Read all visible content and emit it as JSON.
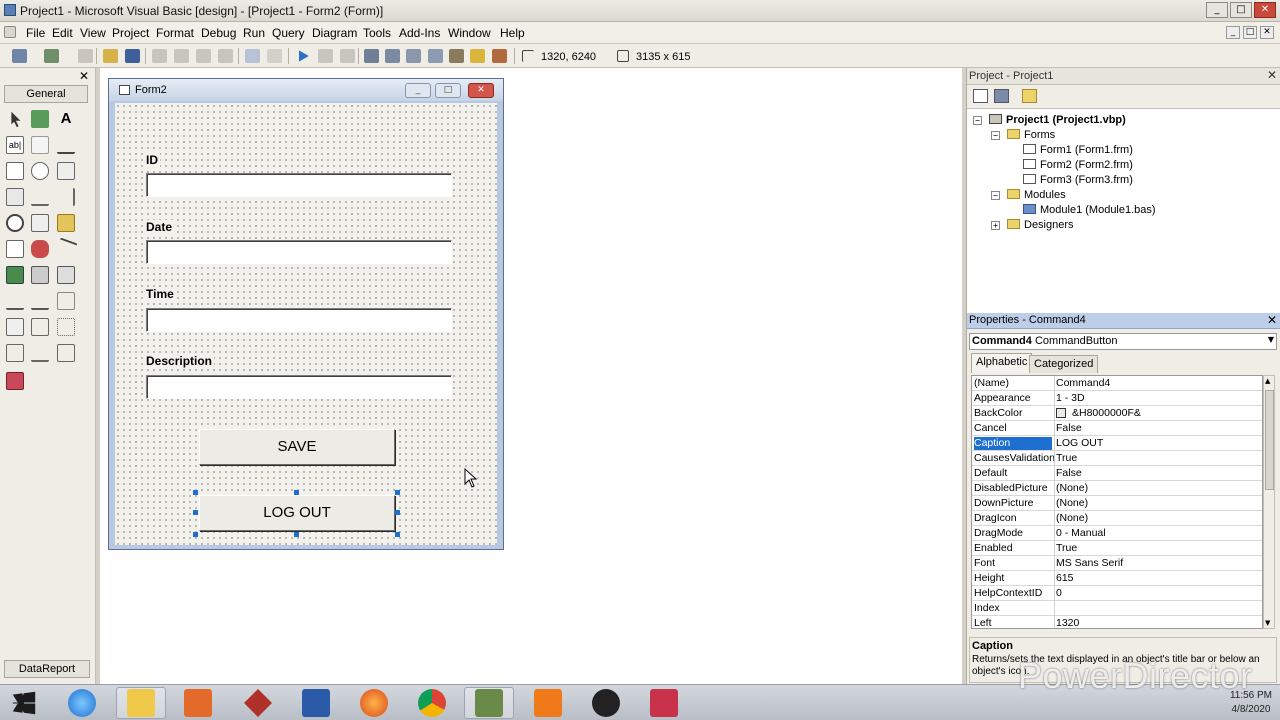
{
  "window": {
    "title": "Project1 - Microsoft Visual Basic [design] - [Project1 - Form2 (Form)]",
    "min": "_",
    "max": "□",
    "close": "✕"
  },
  "menu": [
    "File",
    "Edit",
    "View",
    "Project",
    "Format",
    "Debug",
    "Run",
    "Query",
    "Diagram",
    "Tools",
    "Add-Ins",
    "Window",
    "Help"
  ],
  "toolbar": {
    "position": "1320, 6240",
    "size": "3135 x 615"
  },
  "toolbox": {
    "title": "General",
    "close": "✕",
    "footer": "DataReport"
  },
  "form": {
    "title": "Form2",
    "labels": {
      "id": "ID",
      "date": "Date",
      "time": "Time",
      "description": "Description"
    },
    "inputs": {
      "id": "",
      "date": "",
      "time": "",
      "description": ""
    },
    "buttons": {
      "save": "SAVE",
      "logout": "LOG OUT"
    }
  },
  "project": {
    "title": "Project - Project1",
    "close": "✕",
    "tree": {
      "root": "Project1 (Project1.vbp)",
      "forms_folder": "Forms",
      "forms": [
        "Form1 (Form1.frm)",
        "Form2 (Form2.frm)",
        "Form3 (Form3.frm)"
      ],
      "modules_folder": "Modules",
      "modules": [
        "Module1 (Module1.bas)"
      ],
      "designers_folder": "Designers"
    }
  },
  "properties": {
    "title": "Properties - Command4",
    "close": "✕",
    "object": "Command4",
    "object_type": "CommandButton",
    "tabs": [
      "Alphabetic",
      "Categorized"
    ],
    "rows": [
      {
        "name": "(Name)",
        "value": "Command4"
      },
      {
        "name": "Appearance",
        "value": "1 - 3D"
      },
      {
        "name": "BackColor",
        "value": "&H8000000F&"
      },
      {
        "name": "Cancel",
        "value": "False"
      },
      {
        "name": "Caption",
        "value": "LOG OUT"
      },
      {
        "name": "CausesValidation",
        "value": "True"
      },
      {
        "name": "Default",
        "value": "False"
      },
      {
        "name": "DisabledPicture",
        "value": "(None)"
      },
      {
        "name": "DownPicture",
        "value": "(None)"
      },
      {
        "name": "DragIcon",
        "value": "(None)"
      },
      {
        "name": "DragMode",
        "value": "0 - Manual"
      },
      {
        "name": "Enabled",
        "value": "True"
      },
      {
        "name": "Font",
        "value": "MS Sans Serif"
      },
      {
        "name": "Height",
        "value": "615"
      },
      {
        "name": "HelpContextID",
        "value": "0"
      },
      {
        "name": "Index",
        "value": ""
      },
      {
        "name": "Left",
        "value": "1320"
      }
    ],
    "selected_row": 4,
    "desc_title": "Caption",
    "desc_text": "Returns/sets the text displayed in an object's title bar or below an object's icon."
  },
  "taskbar": {
    "time": "11:56 PM",
    "date": "4/8/2020"
  },
  "watermark": "PowerDirector",
  "colors": {
    "selection": "#1f6fd0",
    "title_gradient": "#c6d3e6",
    "props_header": "#bdcfe8"
  }
}
